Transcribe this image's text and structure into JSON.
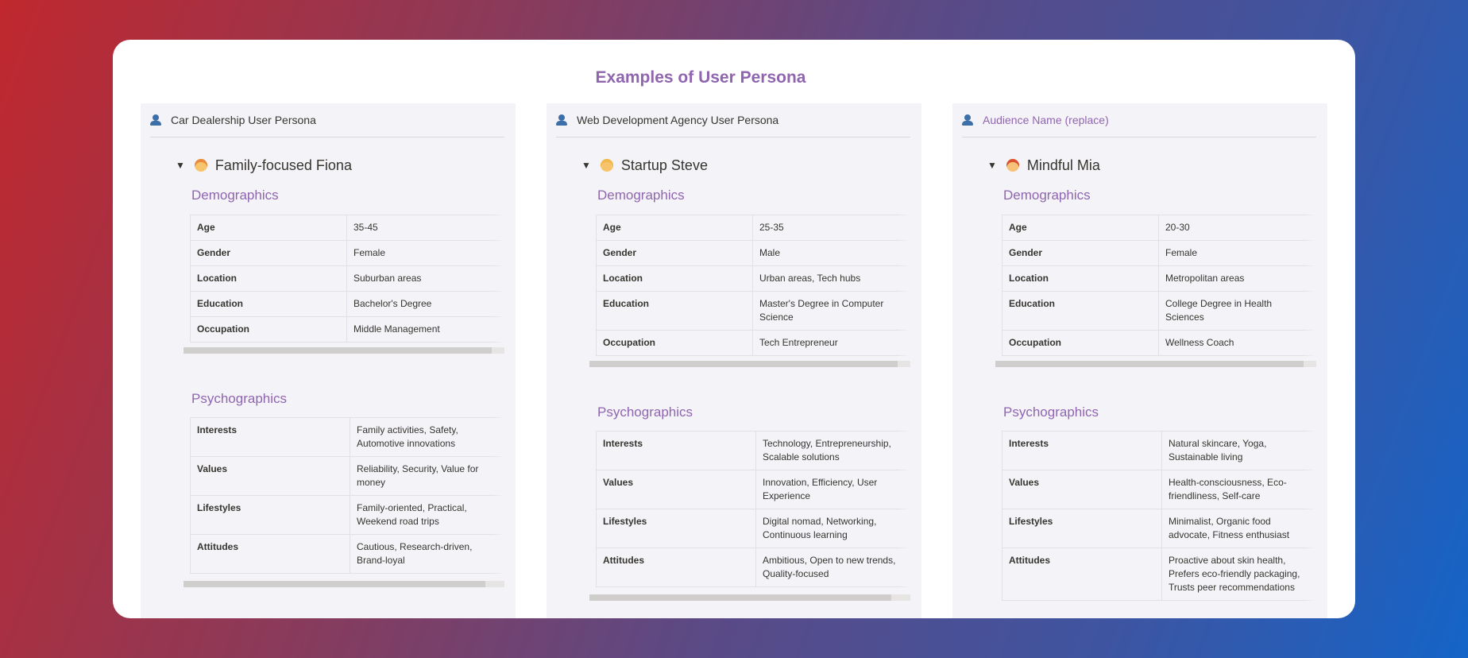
{
  "page": {
    "title": "Examples of User Persona"
  },
  "colors": {
    "accent": "#9065b0",
    "text": "#37352f",
    "panel": "#f4f3f8"
  },
  "columns": [
    {
      "header": "Car Dealership User Persona",
      "header_icon": "person-icon",
      "persona": {
        "name": "Family-focused Fiona",
        "emoji": "woman-emoji"
      },
      "demographics_title": "Demographics",
      "demographics": [
        {
          "key": "Age",
          "value": "35-45"
        },
        {
          "key": "Gender",
          "value": "Female"
        },
        {
          "key": "Location",
          "value": "Suburban areas"
        },
        {
          "key": "Education",
          "value": "Bachelor's Degree"
        },
        {
          "key": "Occupation",
          "value": "Middle Management"
        }
      ],
      "psychographics_title": "Psychographics",
      "psychographics": [
        {
          "key": "Interests",
          "value": "Family activities, Safety, Automotive innovations"
        },
        {
          "key": "Values",
          "value": "Reliability, Security, Value for money"
        },
        {
          "key": "Lifestyles",
          "value": "Family-oriented, Practical, Weekend road trips"
        },
        {
          "key": "Attitudes",
          "value": "Cautious, Research-driven, Brand-loyal"
        }
      ]
    },
    {
      "header": "Web Development Agency User Persona",
      "header_icon": "person-icon",
      "persona": {
        "name": "Startup Steve",
        "emoji": "man-emoji"
      },
      "demographics_title": "Demographics",
      "demographics": [
        {
          "key": "Age",
          "value": "25-35"
        },
        {
          "key": "Gender",
          "value": "Male"
        },
        {
          "key": "Location",
          "value": "Urban areas, Tech hubs"
        },
        {
          "key": "Education",
          "value": "Master's Degree in Computer Science"
        },
        {
          "key": "Occupation",
          "value": "Tech Entrepreneur"
        }
      ],
      "psychographics_title": "Psychographics",
      "psychographics": [
        {
          "key": "Interests",
          "value": "Technology, Entrepreneurship, Scalable solutions"
        },
        {
          "key": "Values",
          "value": "Innovation, Efficiency, User Experience"
        },
        {
          "key": "Lifestyles",
          "value": "Digital nomad, Networking, Continuous learning"
        },
        {
          "key": "Attitudes",
          "value": "Ambitious, Open to new trends, Quality-focused"
        }
      ]
    },
    {
      "header": "Audience Name (replace)",
      "header_icon": "person-icon",
      "persona": {
        "name": "Mindful Mia",
        "emoji": "woman-red-hair-emoji"
      },
      "demographics_title": "Demographics",
      "demographics": [
        {
          "key": "Age",
          "value": "20-30"
        },
        {
          "key": "Gender",
          "value": "Female"
        },
        {
          "key": "Location",
          "value": "Metropolitan areas"
        },
        {
          "key": "Education",
          "value": "College Degree in Health Sciences"
        },
        {
          "key": "Occupation",
          "value": "Wellness Coach"
        }
      ],
      "psychographics_title": "Psychographics",
      "psychographics": [
        {
          "key": "Interests",
          "value": "Natural skincare, Yoga, Sustainable living"
        },
        {
          "key": "Values",
          "value": "Health-consciousness, Eco-friendliness, Self-care"
        },
        {
          "key": "Lifestyles",
          "value": "Minimalist, Organic food advocate, Fitness enthusiast"
        },
        {
          "key": "Attitudes",
          "value": "Proactive about skin health, Prefers eco-friendly packaging, Trusts peer recommendations"
        }
      ]
    }
  ]
}
